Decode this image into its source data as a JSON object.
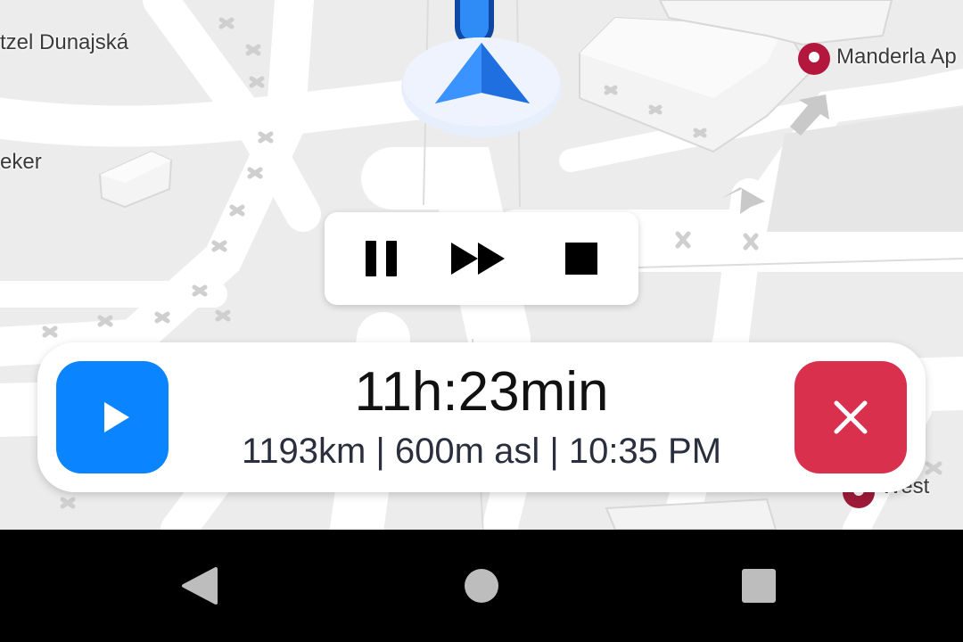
{
  "map": {
    "labels": {
      "place_1": "tzel Dunajská",
      "place_2": "eker",
      "poi_1": "Manderla Ap",
      "poi_2": "West"
    },
    "colors": {
      "background": "#ececec",
      "road": "#ffffff",
      "route": "#1a73e8",
      "location_arrow": "#1f7ef0",
      "poi_pin": "#b3173d"
    }
  },
  "media_controls": {
    "pause_icon": "pause-icon",
    "fast_forward_icon": "fast-forward-icon",
    "stop_icon": "stop-icon"
  },
  "route_panel": {
    "duration": "11h:23min",
    "details": "1193km | 600m asl | 10:35 PM",
    "start_icon": "play-icon",
    "cancel_icon": "close-icon",
    "colors": {
      "start_button": "#0a84ff",
      "cancel_button": "#d9304d"
    }
  },
  "nav_bar": {
    "back_icon": "back-triangle-icon",
    "home_icon": "home-circle-icon",
    "recents_icon": "recents-square-icon"
  }
}
